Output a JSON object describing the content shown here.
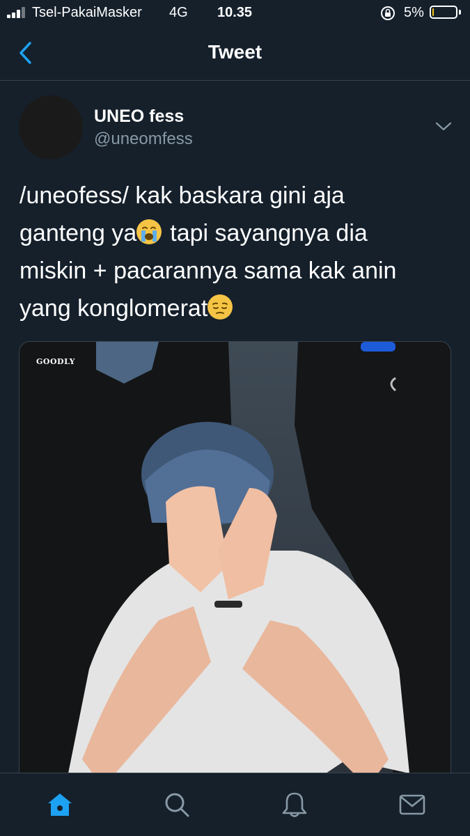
{
  "status_bar": {
    "carrier": "Tsel-PakaiMasker",
    "network": "4G",
    "time": "10.35",
    "battery_percent": "5%",
    "battery_level": 0.05
  },
  "header": {
    "title": "Tweet",
    "back_icon": "chevron-left-icon"
  },
  "tweet": {
    "author": {
      "display_name": "UNEO fess",
      "handle": "@uneomfess"
    },
    "menu_icon": "chevron-down-icon",
    "text_lines": [
      "/uneofess/ kak baskara gini aja",
      "ganteng ya",
      "tapi sayangnya dia",
      "miskin + pacarannya sama kak anin",
      "yang konglomerat"
    ],
    "emojis": [
      "loudly-crying-face-emoji",
      "pensive-face-emoji"
    ],
    "media": {
      "watermark": "GOODLY"
    }
  },
  "tab_bar": {
    "tabs": [
      "home-icon",
      "search-icon",
      "notifications-icon",
      "messages-icon"
    ],
    "active": "home-icon"
  },
  "colors": {
    "background": "#15202b",
    "accent": "#1da1f2",
    "secondary_text": "#8899a6",
    "divider": "#38444d"
  }
}
